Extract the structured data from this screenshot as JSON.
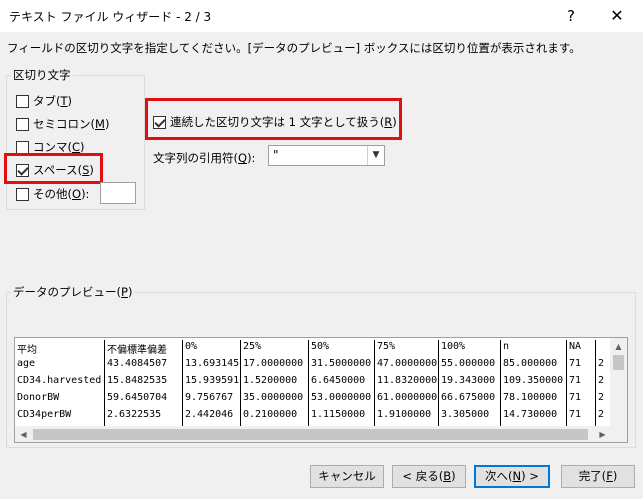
{
  "window": {
    "title": "テキスト ファイル ウィザード - 2 / 3",
    "help_label": "?",
    "close_label": "✕"
  },
  "instruction": "フィールドの区切り文字を指定してください。[データのプレビュー] ボックスには区切り位置が表示されます。",
  "delimiters": {
    "group_title": "区切り文字",
    "tab": {
      "label": "タブ(",
      "key": "T",
      "suffix": ")",
      "checked": false
    },
    "semicolon": {
      "label": "セミコロン(",
      "key": "M",
      "suffix": ")",
      "checked": false
    },
    "comma": {
      "label": "コンマ(",
      "key": "C",
      "suffix": ")",
      "checked": false
    },
    "space": {
      "label": "スペース(",
      "key": "S",
      "suffix": ")",
      "checked": true
    },
    "other": {
      "label": "その他(",
      "key": "O",
      "suffix": "):",
      "checked": false,
      "value": ""
    }
  },
  "consecutive": {
    "label": "連続した区切り文字は 1 文字として扱う(",
    "key": "R",
    "suffix": ")",
    "checked": true
  },
  "quote": {
    "label": "文字列の引用符(",
    "key": "Q",
    "suffix": "):",
    "value": "\""
  },
  "preview": {
    "title": "データのプレビュー(",
    "key": "P",
    "suffix": ")",
    "rows": [
      [
        "平均",
        "不偏標準偏差",
        "0%",
        "25%",
        "50%",
        "75%",
        "100%",
        "n",
        "NA",
        ""
      ],
      [
        "age",
        "43.4084507",
        "13.693145",
        "17.0000000",
        "31.5000000",
        "47.0000000",
        "55.000000",
        "85.000000",
        "71",
        "2"
      ],
      [
        "CD34.harvested",
        "15.8482535",
        "15.939591",
        "1.5200000",
        "6.6450000",
        "11.8320000",
        "19.343000",
        "109.350000",
        "71",
        "2"
      ],
      [
        "DonorBW",
        "59.6450704",
        "9.756767",
        "35.0000000",
        "53.0000000",
        "61.0000000",
        "66.675000",
        "78.100000",
        "71",
        "2"
      ],
      [
        "CD34perBW",
        "2.6322535",
        "2.442046",
        "0.2100000",
        "1.1150000",
        "1.9100000",
        "3.305000",
        "14.730000",
        "71",
        "2"
      ]
    ]
  },
  "buttons": {
    "cancel": "キャンセル",
    "back": "< 戻る(",
    "back_key": "B",
    "back_suffix": ")",
    "next": "次へ(",
    "next_key": "N",
    "next_suffix": ") >",
    "finish": "完了(",
    "finish_key": "F",
    "finish_suffix": ")"
  },
  "colors": {
    "highlight": "#e01010",
    "accent": "#0078d7"
  }
}
